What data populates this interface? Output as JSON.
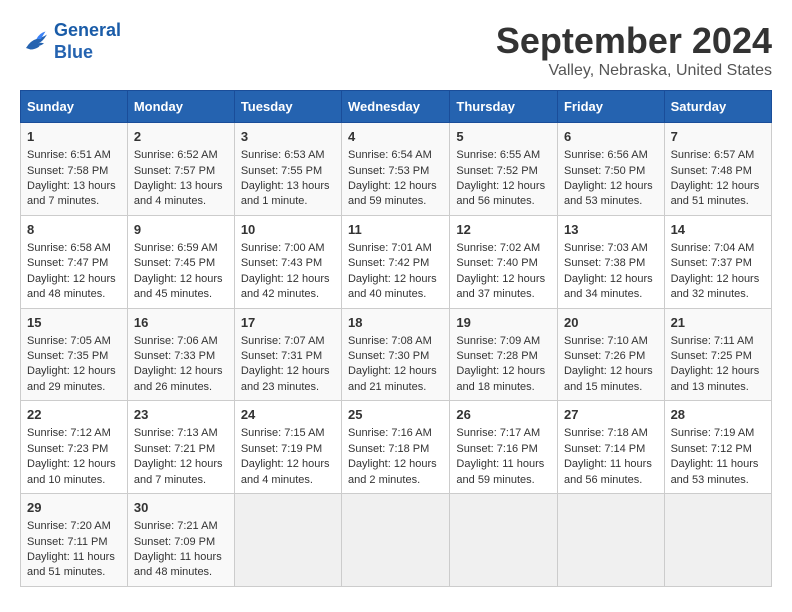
{
  "logo": {
    "line1": "General",
    "line2": "Blue"
  },
  "title": "September 2024",
  "subtitle": "Valley, Nebraska, United States",
  "days_header": [
    "Sunday",
    "Monday",
    "Tuesday",
    "Wednesday",
    "Thursday",
    "Friday",
    "Saturday"
  ],
  "weeks": [
    [
      {
        "day": "1",
        "sunrise": "6:51 AM",
        "sunset": "7:58 PM",
        "daylight": "13 hours and 7 minutes."
      },
      {
        "day": "2",
        "sunrise": "6:52 AM",
        "sunset": "7:57 PM",
        "daylight": "13 hours and 4 minutes."
      },
      {
        "day": "3",
        "sunrise": "6:53 AM",
        "sunset": "7:55 PM",
        "daylight": "13 hours and 1 minute."
      },
      {
        "day": "4",
        "sunrise": "6:54 AM",
        "sunset": "7:53 PM",
        "daylight": "12 hours and 59 minutes."
      },
      {
        "day": "5",
        "sunrise": "6:55 AM",
        "sunset": "7:52 PM",
        "daylight": "12 hours and 56 minutes."
      },
      {
        "day": "6",
        "sunrise": "6:56 AM",
        "sunset": "7:50 PM",
        "daylight": "12 hours and 53 minutes."
      },
      {
        "day": "7",
        "sunrise": "6:57 AM",
        "sunset": "7:48 PM",
        "daylight": "12 hours and 51 minutes."
      }
    ],
    [
      {
        "day": "8",
        "sunrise": "6:58 AM",
        "sunset": "7:47 PM",
        "daylight": "12 hours and 48 minutes."
      },
      {
        "day": "9",
        "sunrise": "6:59 AM",
        "sunset": "7:45 PM",
        "daylight": "12 hours and 45 minutes."
      },
      {
        "day": "10",
        "sunrise": "7:00 AM",
        "sunset": "7:43 PM",
        "daylight": "12 hours and 42 minutes."
      },
      {
        "day": "11",
        "sunrise": "7:01 AM",
        "sunset": "7:42 PM",
        "daylight": "12 hours and 40 minutes."
      },
      {
        "day": "12",
        "sunrise": "7:02 AM",
        "sunset": "7:40 PM",
        "daylight": "12 hours and 37 minutes."
      },
      {
        "day": "13",
        "sunrise": "7:03 AM",
        "sunset": "7:38 PM",
        "daylight": "12 hours and 34 minutes."
      },
      {
        "day": "14",
        "sunrise": "7:04 AM",
        "sunset": "7:37 PM",
        "daylight": "12 hours and 32 minutes."
      }
    ],
    [
      {
        "day": "15",
        "sunrise": "7:05 AM",
        "sunset": "7:35 PM",
        "daylight": "12 hours and 29 minutes."
      },
      {
        "day": "16",
        "sunrise": "7:06 AM",
        "sunset": "7:33 PM",
        "daylight": "12 hours and 26 minutes."
      },
      {
        "day": "17",
        "sunrise": "7:07 AM",
        "sunset": "7:31 PM",
        "daylight": "12 hours and 23 minutes."
      },
      {
        "day": "18",
        "sunrise": "7:08 AM",
        "sunset": "7:30 PM",
        "daylight": "12 hours and 21 minutes."
      },
      {
        "day": "19",
        "sunrise": "7:09 AM",
        "sunset": "7:28 PM",
        "daylight": "12 hours and 18 minutes."
      },
      {
        "day": "20",
        "sunrise": "7:10 AM",
        "sunset": "7:26 PM",
        "daylight": "12 hours and 15 minutes."
      },
      {
        "day": "21",
        "sunrise": "7:11 AM",
        "sunset": "7:25 PM",
        "daylight": "12 hours and 13 minutes."
      }
    ],
    [
      {
        "day": "22",
        "sunrise": "7:12 AM",
        "sunset": "7:23 PM",
        "daylight": "12 hours and 10 minutes."
      },
      {
        "day": "23",
        "sunrise": "7:13 AM",
        "sunset": "7:21 PM",
        "daylight": "12 hours and 7 minutes."
      },
      {
        "day": "24",
        "sunrise": "7:15 AM",
        "sunset": "7:19 PM",
        "daylight": "12 hours and 4 minutes."
      },
      {
        "day": "25",
        "sunrise": "7:16 AM",
        "sunset": "7:18 PM",
        "daylight": "12 hours and 2 minutes."
      },
      {
        "day": "26",
        "sunrise": "7:17 AM",
        "sunset": "7:16 PM",
        "daylight": "11 hours and 59 minutes."
      },
      {
        "day": "27",
        "sunrise": "7:18 AM",
        "sunset": "7:14 PM",
        "daylight": "11 hours and 56 minutes."
      },
      {
        "day": "28",
        "sunrise": "7:19 AM",
        "sunset": "7:12 PM",
        "daylight": "11 hours and 53 minutes."
      }
    ],
    [
      {
        "day": "29",
        "sunrise": "7:20 AM",
        "sunset": "7:11 PM",
        "daylight": "11 hours and 51 minutes."
      },
      {
        "day": "30",
        "sunrise": "7:21 AM",
        "sunset": "7:09 PM",
        "daylight": "11 hours and 48 minutes."
      },
      null,
      null,
      null,
      null,
      null
    ]
  ]
}
